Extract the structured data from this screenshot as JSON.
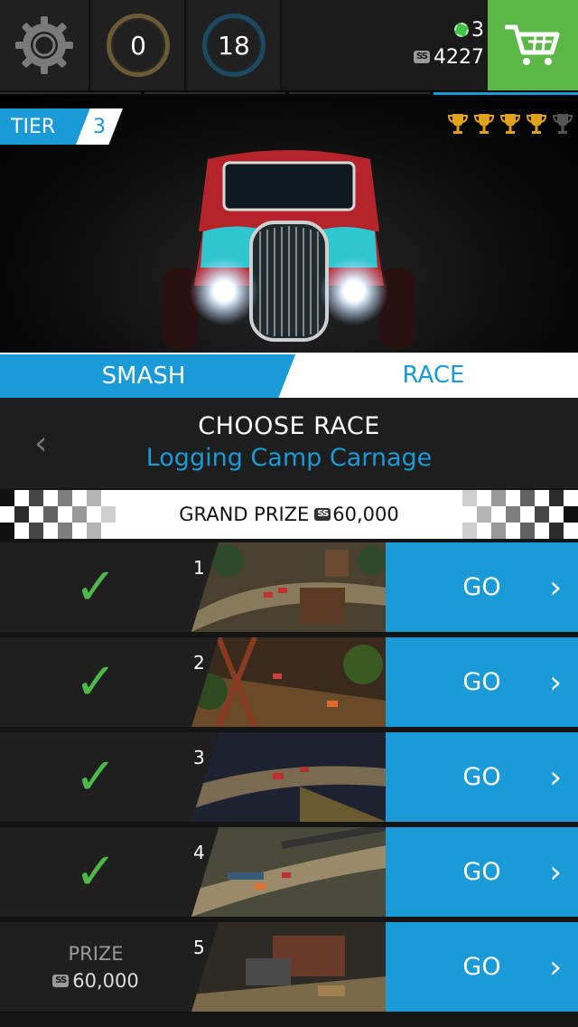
{
  "topbar": {
    "ring_left_value": "0",
    "ring_right_value": "18",
    "chips": "3",
    "cash_icon": "SS",
    "cash": "4227",
    "shop_icon": "cart-icon"
  },
  "tier": {
    "label": "TIER",
    "number": "3"
  },
  "trophies": {
    "earned": 4,
    "total": 5,
    "colors": {
      "earned": "#e0a21c",
      "empty": "#555555"
    }
  },
  "tabs": {
    "smash": "SMASH",
    "race": "RACE",
    "active": "smash"
  },
  "choose": {
    "title": "CHOOSE RACE",
    "event": "Logging Camp Carnage"
  },
  "grand_prize": {
    "label": "GRAND PRIZE",
    "icon": "SS",
    "amount": "60,000"
  },
  "races": [
    {
      "number": "1",
      "completed": true,
      "go": "GO"
    },
    {
      "number": "2",
      "completed": true,
      "go": "GO"
    },
    {
      "number": "3",
      "completed": true,
      "go": "GO"
    },
    {
      "number": "4",
      "completed": true,
      "go": "GO"
    },
    {
      "number": "5",
      "completed": false,
      "prize_label": "PRIZE",
      "prize_icon": "SS",
      "prize_amount": "60,000",
      "go": "GO"
    }
  ],
  "colors": {
    "accent": "#1a9ad6",
    "shop": "#5cb846",
    "check": "#4fb84a"
  }
}
